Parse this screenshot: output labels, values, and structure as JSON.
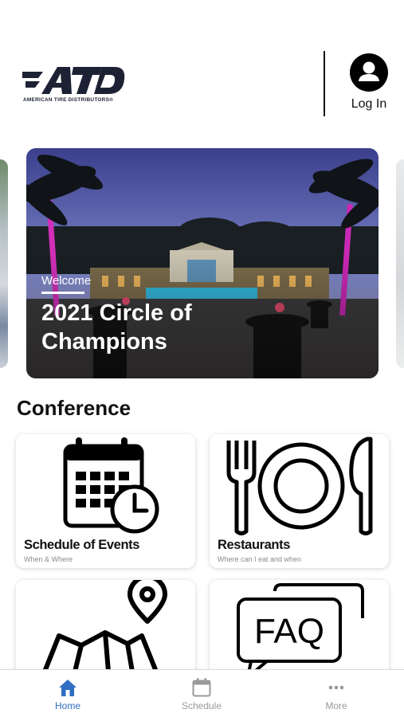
{
  "header": {
    "logo_text": "ATD",
    "logo_subtitle": "AMERICAN TIRE DISTRIBUTORS®",
    "login_label": "Log In"
  },
  "hero": {
    "eyebrow": "Welcome",
    "title": "2021 Circle of Champions"
  },
  "section": {
    "title": "Conference"
  },
  "cards": [
    {
      "title": "Schedule of Events",
      "subtitle": "When & Where",
      "icon": "calendar-clock-icon"
    },
    {
      "title": "Restaurants",
      "subtitle": "Where can I eat and when",
      "icon": "fork-plate-knife-icon"
    },
    {
      "title": "",
      "subtitle": "",
      "icon": "map-pin-icon"
    },
    {
      "title": "",
      "subtitle": "",
      "icon": "faq-bubbles-icon"
    }
  ],
  "tabbar": {
    "tabs": [
      {
        "label": "Home",
        "icon": "home-icon",
        "active": true
      },
      {
        "label": "Schedule",
        "icon": "calendar-icon",
        "active": false
      },
      {
        "label": "More",
        "icon": "more-dots-icon",
        "active": false
      }
    ]
  },
  "colors": {
    "accent": "#2f6ec0",
    "inactive_tab": "#9a9a9a",
    "logo_navy": "#1c2233"
  }
}
